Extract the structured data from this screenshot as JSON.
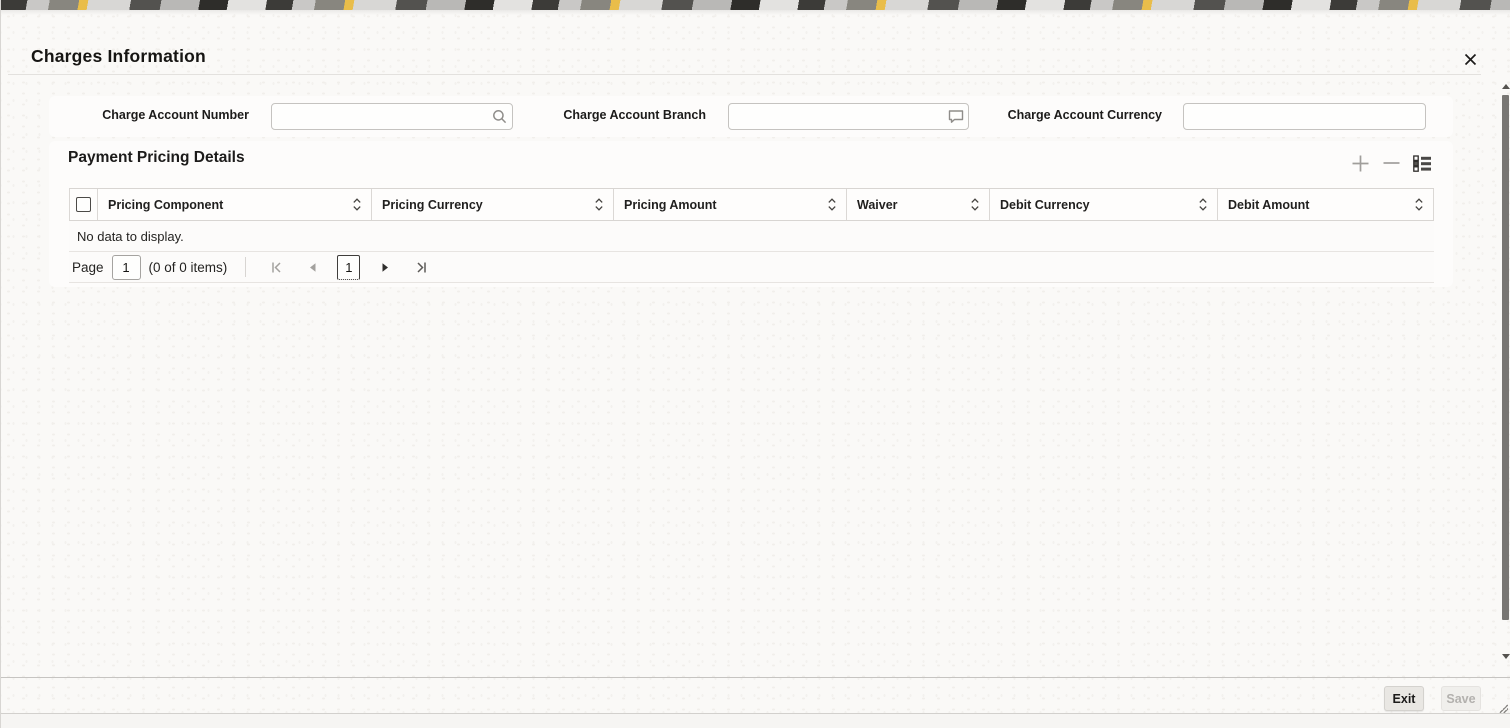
{
  "window": {
    "title": "Charges Information"
  },
  "form": {
    "fields": [
      {
        "label": "Charge Account Number",
        "value": "",
        "icon": "search-icon"
      },
      {
        "label": "Charge Account Branch",
        "value": "",
        "icon": "comment-icon"
      },
      {
        "label": "Charge Account Currency",
        "value": "",
        "icon": ""
      }
    ]
  },
  "section": {
    "title": "Payment Pricing Details"
  },
  "table": {
    "columns": [
      {
        "label": "Pricing Component"
      },
      {
        "label": "Pricing Currency"
      },
      {
        "label": "Pricing Amount"
      },
      {
        "label": "Waiver"
      },
      {
        "label": "Debit Currency"
      },
      {
        "label": "Debit Amount"
      }
    ],
    "rows": [],
    "empty_message": "No data to display."
  },
  "pagination": {
    "page_label": "Page",
    "page_input_value": "1",
    "items_summary": "(0 of 0 items)",
    "current_page": "1"
  },
  "footer": {
    "exit_label": "Exit",
    "save_label": "Save"
  },
  "colors": {
    "accent_yellow": "#e9bd4a",
    "text_primary": "#161513",
    "card_background": "#fdfcfb",
    "border_light": "#d8d5d2"
  }
}
